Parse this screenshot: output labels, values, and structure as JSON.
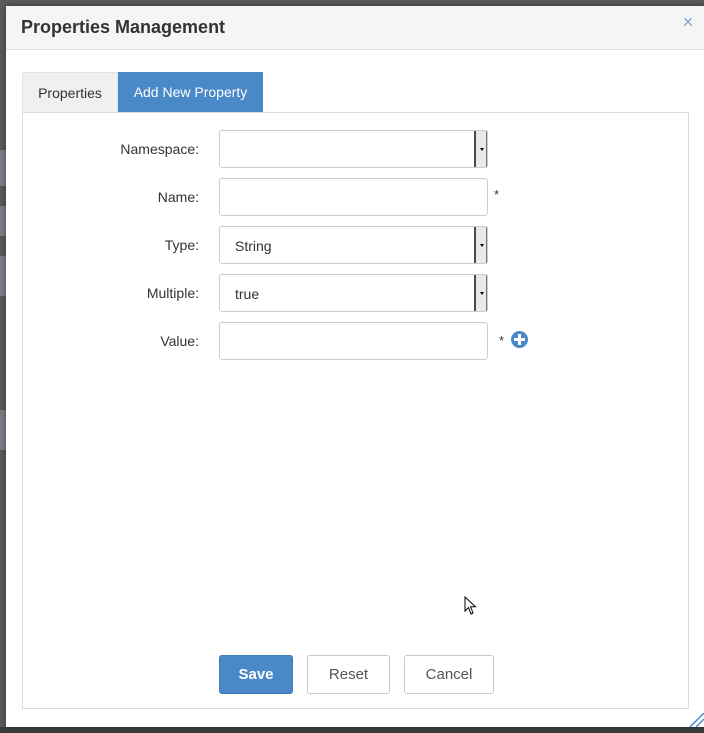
{
  "dialog": {
    "title": "Properties Management",
    "close_icon": "close-icon"
  },
  "tabs": [
    {
      "label": "Properties",
      "active": false
    },
    {
      "label": "Add New Property",
      "active": true
    }
  ],
  "form": {
    "namespace": {
      "label": "Namespace:",
      "value": ""
    },
    "name": {
      "label": "Name:",
      "value": "",
      "required": "*"
    },
    "type": {
      "label": "Type:",
      "value": "String"
    },
    "multiple": {
      "label": "Multiple:",
      "value": "true"
    },
    "value": {
      "label": "Value:",
      "value": "",
      "required": "*",
      "add_icon": "plus-circle-icon"
    }
  },
  "buttons": {
    "save": "Save",
    "reset": "Reset",
    "cancel": "Cancel"
  },
  "colors": {
    "accent": "#4a89c7",
    "header_bg": "#f5f5f5"
  }
}
